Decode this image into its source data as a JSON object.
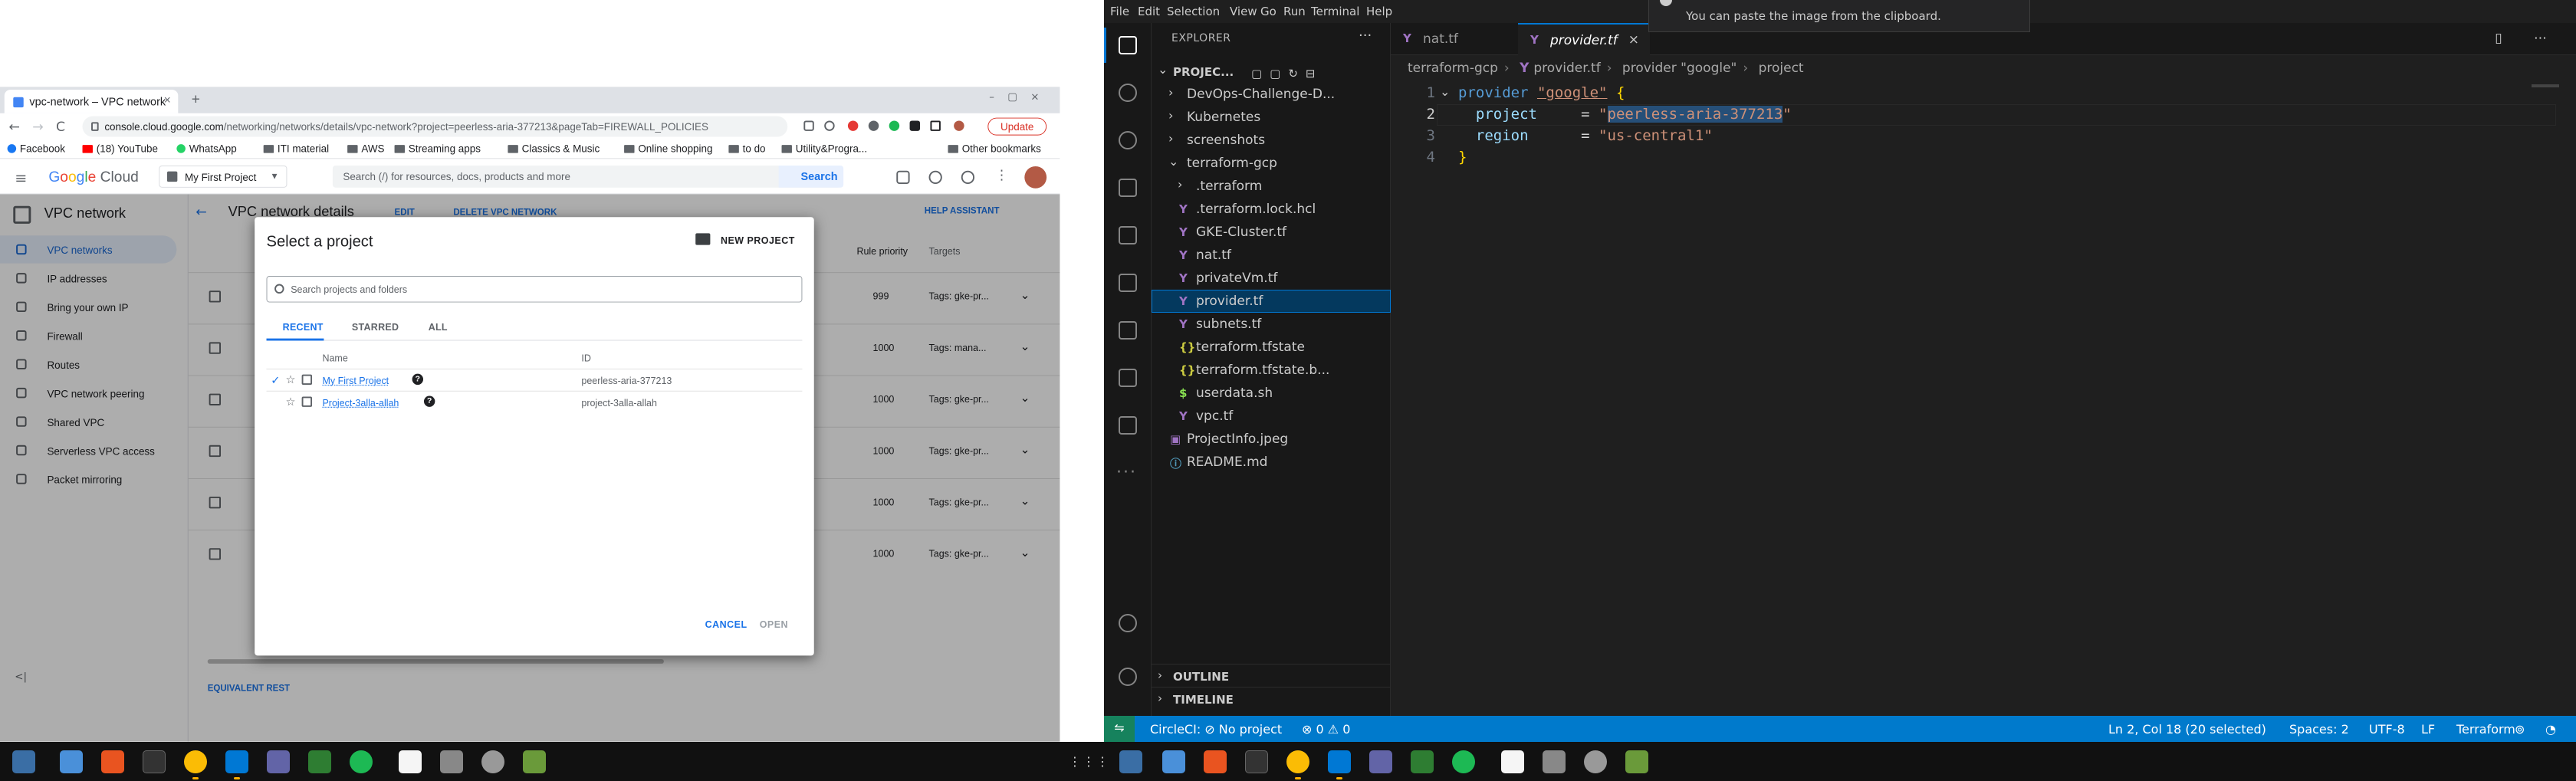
{
  "chrome": {
    "tab_title": "vpc-network – VPC network",
    "tab_close": "×",
    "new_tab": "+",
    "window_controls": "–▢×",
    "nav_back": "←",
    "nav_forward": "→",
    "nav_reload": "C",
    "url_host": "console.cloud.google.com",
    "url_path": "/networking/networks/details/vpc-network?project=peerless-aria-377213&pageTab=FIREWALL_POLICIES",
    "update_label": "Update",
    "bookmarks": [
      "Facebook",
      "(18) YouTube",
      "WhatsApp",
      "ITI material",
      "AWS",
      "Streaming apps",
      "Classics & Music",
      "Online shopping",
      "to do",
      "Utility&Progra..."
    ],
    "other_bookmarks": "Other bookmarks"
  },
  "console": {
    "logo": {
      "g": "G",
      "o1": "o",
      "o2": "o",
      "g2": "g",
      "l": "l",
      "e": "e",
      "rest": " Cloud"
    },
    "project_selector": "My First Project",
    "search_placeholder": "Search (/) for resources, docs, products and more",
    "search_button": "Search",
    "sidebar_title": "VPC network",
    "sidebar_items": [
      "VPC networks",
      "IP addresses",
      "Bring your own IP",
      "Firewall",
      "Routes",
      "VPC network peering",
      "Shared VPC",
      "Serverless VPC access",
      "Packet mirroring"
    ],
    "page_title": "VPC network details",
    "edit_label": "EDIT",
    "delete_label": "DELETE VPC NETWORK",
    "help_label": "HELP ASSISTANT",
    "table_headers": {
      "priority": "Rule priority",
      "targets": "Targets"
    },
    "rows": [
      {
        "priority": "999",
        "targets": "Tags: gke-pr..."
      },
      {
        "priority": "1000",
        "targets": "Tags: mana..."
      },
      {
        "priority": "1000",
        "targets": "Tags: gke-pr..."
      },
      {
        "priority": "1000",
        "targets": "Tags: gke-pr..."
      },
      {
        "priority": "1000",
        "targets": "Tags: gke-pr..."
      },
      {
        "priority": "1000",
        "targets": "Tags: gke-pr..."
      }
    ],
    "equivalent_rest": "EQUIVALENT REST",
    "collapse": "<|"
  },
  "dialog": {
    "title": "Select a project",
    "new_project": "NEW PROJECT",
    "search_placeholder": "Search projects and folders",
    "tabs": [
      "RECENT",
      "STARRED",
      "ALL"
    ],
    "columns": {
      "name": "Name",
      "id": "ID"
    },
    "projects": [
      {
        "name": "My First Project",
        "id": "peerless-aria-377213",
        "selected": true
      },
      {
        "name": "Project-3alla-allah",
        "id": "project-3alla-allah",
        "selected": false
      }
    ],
    "cancel": "CANCEL",
    "open": "OPEN"
  },
  "vscode": {
    "menu": [
      "File",
      "Edit",
      "Selection",
      "View",
      "Go",
      "Run",
      "Terminal",
      "Help"
    ],
    "notification": "You can paste the image from the clipboard.",
    "explorer_title": "EXPLORER",
    "explorer_more": "···",
    "project_root": "PROJEC...",
    "tree": [
      {
        "label": "DevOps-Challenge-D...",
        "kind": "folder",
        "depth": 1
      },
      {
        "label": "Kubernetes",
        "kind": "folder",
        "depth": 1
      },
      {
        "label": "screenshots",
        "kind": "folder",
        "depth": 1
      },
      {
        "label": "terraform-gcp",
        "kind": "folder-open",
        "depth": 1
      },
      {
        "label": ".terraform",
        "kind": "folder",
        "depth": 2
      },
      {
        "label": ".terraform.lock.hcl",
        "kind": "tf",
        "depth": 2
      },
      {
        "label": "GKE-Cluster.tf",
        "kind": "tf",
        "depth": 2
      },
      {
        "label": "nat.tf",
        "kind": "tf",
        "depth": 2
      },
      {
        "label": "privateVm.tf",
        "kind": "tf",
        "depth": 2
      },
      {
        "label": "provider.tf",
        "kind": "tf",
        "depth": 2,
        "selected": true
      },
      {
        "label": "subnets.tf",
        "kind": "tf",
        "depth": 2
      },
      {
        "label": "terraform.tfstate",
        "kind": "json",
        "depth": 2
      },
      {
        "label": "terraform.tfstate.b...",
        "kind": "json",
        "depth": 2
      },
      {
        "label": "userdata.sh",
        "kind": "sh",
        "depth": 2
      },
      {
        "label": "vpc.tf",
        "kind": "tf",
        "depth": 2
      },
      {
        "label": "ProjectInfo.jpeg",
        "kind": "img",
        "depth": 1
      },
      {
        "label": "README.md",
        "kind": "info",
        "depth": 1
      }
    ],
    "outline": "OUTLINE",
    "timeline": "TIMELINE",
    "tabs": [
      {
        "label": "nat.tf",
        "active": false
      },
      {
        "label": "provider.tf",
        "active": true
      }
    ],
    "tab_close": "×",
    "breadcrumbs": [
      "terraform-gcp",
      "provider.tf",
      "provider \"google\"",
      "project"
    ],
    "code": {
      "line_numbers": [
        "1",
        "2",
        "3",
        "4"
      ],
      "l1_kw": "provider",
      "l1_str": "\"google\"",
      "l1_brace": "{",
      "l2_key": "project",
      "l2_eq": "     = ",
      "l2_q1": "\"",
      "l2_sel": "peerless-aria-377213",
      "l2_q2": "\"",
      "l3_key": "region",
      "l3_eq": "      = ",
      "l3_val": "\"us-central1\"",
      "l4_brace": "}"
    },
    "status": {
      "circleci": "CircleCI: ⊘ No project",
      "problems": "⊗ 0 ⚠ 0",
      "position": "Ln 2, Col 18 (20 selected)",
      "spaces": "Spaces: 2",
      "encoding": "UTF-8",
      "eol": "LF",
      "language": "Terraform"
    }
  }
}
